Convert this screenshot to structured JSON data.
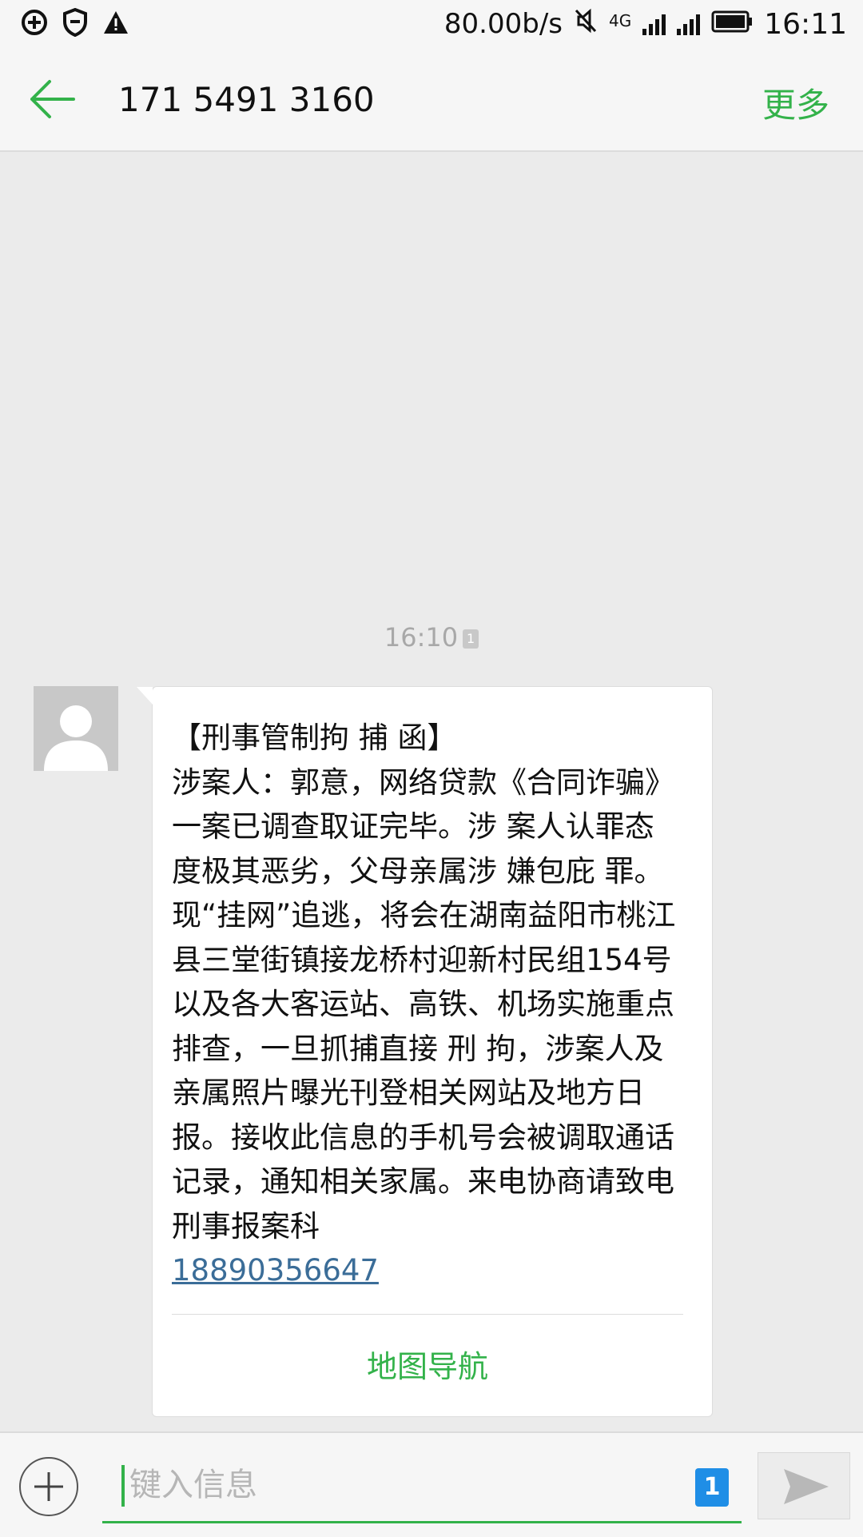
{
  "status_bar": {
    "speed": "80.00b/s",
    "network": "4G",
    "time": "16:11",
    "icons": [
      "vpn-icon",
      "shield-icon",
      "warning-icon",
      "mute-icon",
      "signal-icon",
      "battery-icon"
    ]
  },
  "header": {
    "title": "171 5491 3160",
    "more_label": "更多",
    "back_icon": "arrow-left-icon"
  },
  "thread": {
    "timestamp": "16:10",
    "sim_badge": "1",
    "message": {
      "text": "【刑事管制拘 捕 函】\n涉案人：郭意，网络贷款《合同诈骗》一案已调查取证完毕。涉 案人认罪态度极其恶劣，父母亲属涉 嫌包庇 罪。现“挂网”追逃，将会在湖南益阳市桃江县三堂街镇接龙桥村迎新村民组154号以及各大客运站、高铁、机场实施重点排查，一旦抓捕直接 刑 拘，涉案人及亲属照片曝光刊登相关网站及地方日报。接收此信息的手机号会被调取通话记录，通知相关家属。来电协商请致电刑事报案科",
      "link": "18890356647",
      "action_label": "地图导航"
    }
  },
  "input_bar": {
    "placeholder": "键入信息",
    "sim_label": "1",
    "add_icon": "plus-icon",
    "send_icon": "send-icon"
  },
  "colors": {
    "accent": "#33b24a",
    "link": "#3b6d98",
    "sim": "#1f8ee6",
    "background": "#ebebeb"
  }
}
